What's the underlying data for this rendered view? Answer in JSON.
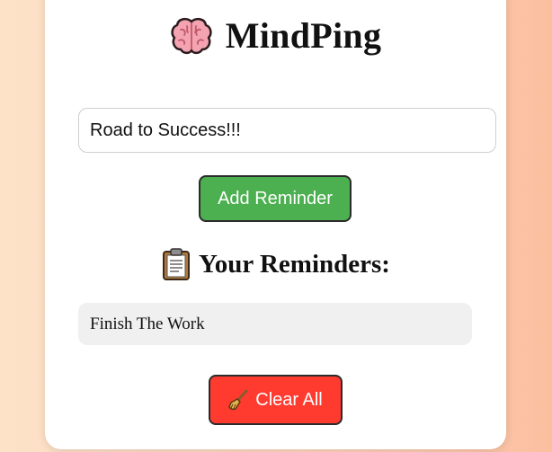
{
  "app": {
    "title": "MindPing",
    "title_icon": "brain-icon"
  },
  "input": {
    "value": "Road to Success!!!",
    "placeholder": ""
  },
  "add_button": {
    "label": "Add Reminder",
    "color": "#4caf50"
  },
  "reminders": {
    "heading": "Your Reminders:",
    "heading_icon": "clipboard-icon",
    "items": [
      {
        "text": "Finish The Work"
      }
    ]
  },
  "clear_button": {
    "label": "Clear All",
    "icon": "broom-icon",
    "color": "#ff3b30"
  }
}
